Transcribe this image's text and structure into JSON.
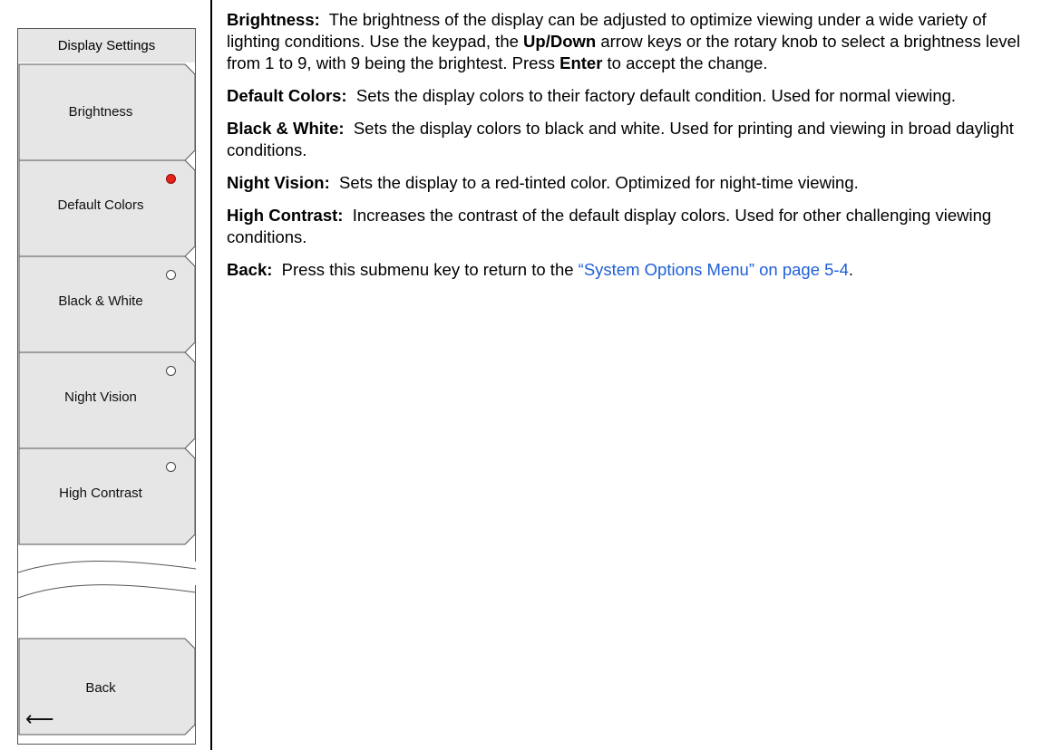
{
  "menu": {
    "title": "Display Settings",
    "keys": [
      {
        "label": "Brightness"
      },
      {
        "label": "Default Colors",
        "radio": "selected"
      },
      {
        "label": "Black & White",
        "radio": "unselected"
      },
      {
        "label": "Night Vision",
        "radio": "unselected"
      },
      {
        "label": "High Contrast",
        "radio": "unselected"
      }
    ],
    "back": {
      "label": "Back",
      "icon": "arrow-left-icon"
    },
    "colors": {
      "key_fill": "#e6e6e6",
      "radio_selected": "#e8221b",
      "link": "#1f5fd6"
    }
  },
  "content": {
    "brightness": {
      "term": "Brightness:",
      "text_1": "The brightness of the display can be adjusted to optimize viewing under a wide variety of lighting conditions. Use the keypad, the",
      "bold_1": "Up/Down",
      "text_2": "arrow keys or the rotary knob to select a brightness level from 1 to 9, with 9 being the brightest. Press",
      "bold_2": "Enter",
      "text_3": "to accept the change."
    },
    "default_colors": {
      "term": "Default Colors:",
      "text": "Sets the display colors to their factory default condition. Used for normal viewing."
    },
    "black_white": {
      "term": "Black & White:",
      "text": "Sets the display colors to black and white. Used for printing and viewing in broad daylight conditions."
    },
    "night_vision": {
      "term": "Night Vision:",
      "text": "Sets the display to a red-tinted color. Optimized for night-time viewing."
    },
    "high_contrast": {
      "term": "High Contrast:",
      "text": "Increases the contrast of the default display colors. Used for other challenging viewing conditions."
    },
    "back": {
      "term": "Back:",
      "text": "Press this submenu key to return to the",
      "link": "“System Options Menu” on page 5-4",
      "end": "."
    }
  }
}
